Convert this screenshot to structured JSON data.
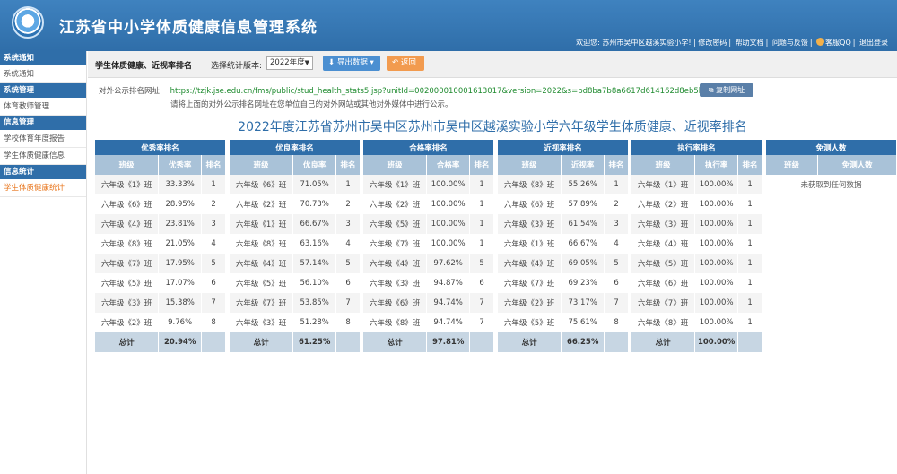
{
  "header": {
    "title": "江苏省中小学体质健康信息管理系统",
    "welcome": "欢迎您: 苏州市吴中区越溪实验小学! |",
    "links": [
      "修改密码",
      "帮助文档",
      "问题与反馈",
      "客服QQ",
      "退出登录"
    ]
  },
  "sidebar": {
    "sections": [
      {
        "title": "系统通知",
        "items": [
          "系统通知"
        ]
      },
      {
        "title": "系统管理",
        "items": [
          "体育教师管理"
        ]
      },
      {
        "title": "信息管理",
        "items": [
          "学校体育年度报告",
          "学生体质健康信息"
        ]
      },
      {
        "title": "信息统计",
        "items": [
          "学生体质健康统计"
        ]
      }
    ],
    "active": "学生体质健康统计"
  },
  "toolbar": {
    "page_name": "学生体质健康、近视率排名",
    "version_label": "选择统计版本:",
    "version_value": "2022年度",
    "export_label": "导出数据",
    "back_label": "返回"
  },
  "url_row": {
    "label": "对外公示排名网址:",
    "url": "https://tzjk.jse.edu.cn/fms/public/stud_health_stats5.jsp?unitId=002000010001613017&version=2022&s=bd8ba7b8a6617d614162d8eb5b28a506",
    "copy_label": "复制网址",
    "tip": "请将上面的对外公示排名网址在您单位自己的对外网站或其他对外媒体中进行公示。"
  },
  "report_title": "2022年度江苏省苏州市吴中区苏州市吴中区越溪实验小学六年级学生体质健康、近视率排名",
  "panels": [
    {
      "caption": "优秀率排名",
      "cols": [
        "班级",
        "优秀率",
        "排名"
      ],
      "rows": [
        [
          "六年级《1》班",
          "33.33%",
          "1"
        ],
        [
          "六年级《6》班",
          "28.95%",
          "2"
        ],
        [
          "六年级《4》班",
          "23.81%",
          "3"
        ],
        [
          "六年级《8》班",
          "21.05%",
          "4"
        ],
        [
          "六年级《7》班",
          "17.95%",
          "5"
        ],
        [
          "六年级《5》班",
          "17.07%",
          "6"
        ],
        [
          "六年级《3》班",
          "15.38%",
          "7"
        ],
        [
          "六年级《2》班",
          "9.76%",
          "8"
        ]
      ],
      "total": [
        "总计",
        "20.94%"
      ]
    },
    {
      "caption": "优良率排名",
      "cols": [
        "班级",
        "优良率",
        "排名"
      ],
      "rows": [
        [
          "六年级《6》班",
          "71.05%",
          "1"
        ],
        [
          "六年级《2》班",
          "70.73%",
          "2"
        ],
        [
          "六年级《1》班",
          "66.67%",
          "3"
        ],
        [
          "六年级《8》班",
          "63.16%",
          "4"
        ],
        [
          "六年级《4》班",
          "57.14%",
          "5"
        ],
        [
          "六年级《5》班",
          "56.10%",
          "6"
        ],
        [
          "六年级《7》班",
          "53.85%",
          "7"
        ],
        [
          "六年级《3》班",
          "51.28%",
          "8"
        ]
      ],
      "total": [
        "总计",
        "61.25%"
      ]
    },
    {
      "caption": "合格率排名",
      "cols": [
        "班级",
        "合格率",
        "排名"
      ],
      "rows": [
        [
          "六年级《1》班",
          "100.00%",
          "1"
        ],
        [
          "六年级《2》班",
          "100.00%",
          "1"
        ],
        [
          "六年级《5》班",
          "100.00%",
          "1"
        ],
        [
          "六年级《7》班",
          "100.00%",
          "1"
        ],
        [
          "六年级《4》班",
          "97.62%",
          "5"
        ],
        [
          "六年级《3》班",
          "94.87%",
          "6"
        ],
        [
          "六年级《6》班",
          "94.74%",
          "7"
        ],
        [
          "六年级《8》班",
          "94.74%",
          "7"
        ]
      ],
      "total": [
        "总计",
        "97.81%"
      ]
    },
    {
      "caption": "近视率排名",
      "cols": [
        "班级",
        "近视率",
        "排名"
      ],
      "rows": [
        [
          "六年级《8》班",
          "55.26%",
          "1"
        ],
        [
          "六年级《6》班",
          "57.89%",
          "2"
        ],
        [
          "六年级《3》班",
          "61.54%",
          "3"
        ],
        [
          "六年级《1》班",
          "66.67%",
          "4"
        ],
        [
          "六年级《4》班",
          "69.05%",
          "5"
        ],
        [
          "六年级《7》班",
          "69.23%",
          "6"
        ],
        [
          "六年级《2》班",
          "73.17%",
          "7"
        ],
        [
          "六年级《5》班",
          "75.61%",
          "8"
        ]
      ],
      "total": [
        "总计",
        "66.25%"
      ]
    },
    {
      "caption": "执行率排名",
      "cols": [
        "班级",
        "执行率",
        "排名"
      ],
      "rows": [
        [
          "六年级《1》班",
          "100.00%",
          "1"
        ],
        [
          "六年级《2》班",
          "100.00%",
          "1"
        ],
        [
          "六年级《3》班",
          "100.00%",
          "1"
        ],
        [
          "六年级《4》班",
          "100.00%",
          "1"
        ],
        [
          "六年级《5》班",
          "100.00%",
          "1"
        ],
        [
          "六年级《6》班",
          "100.00%",
          "1"
        ],
        [
          "六年级《7》班",
          "100.00%",
          "1"
        ],
        [
          "六年级《8》班",
          "100.00%",
          "1"
        ]
      ],
      "total": [
        "总计",
        "100.00%"
      ]
    }
  ],
  "exempt_panel": {
    "caption": "免测人数",
    "cols": [
      "班级",
      "免测人数"
    ],
    "empty_text": "未获取到任何数据"
  },
  "colors": {
    "header_blue": "#2f6ea9",
    "accent_orange": "#e8741a",
    "url_green": "#1f8b2f"
  }
}
